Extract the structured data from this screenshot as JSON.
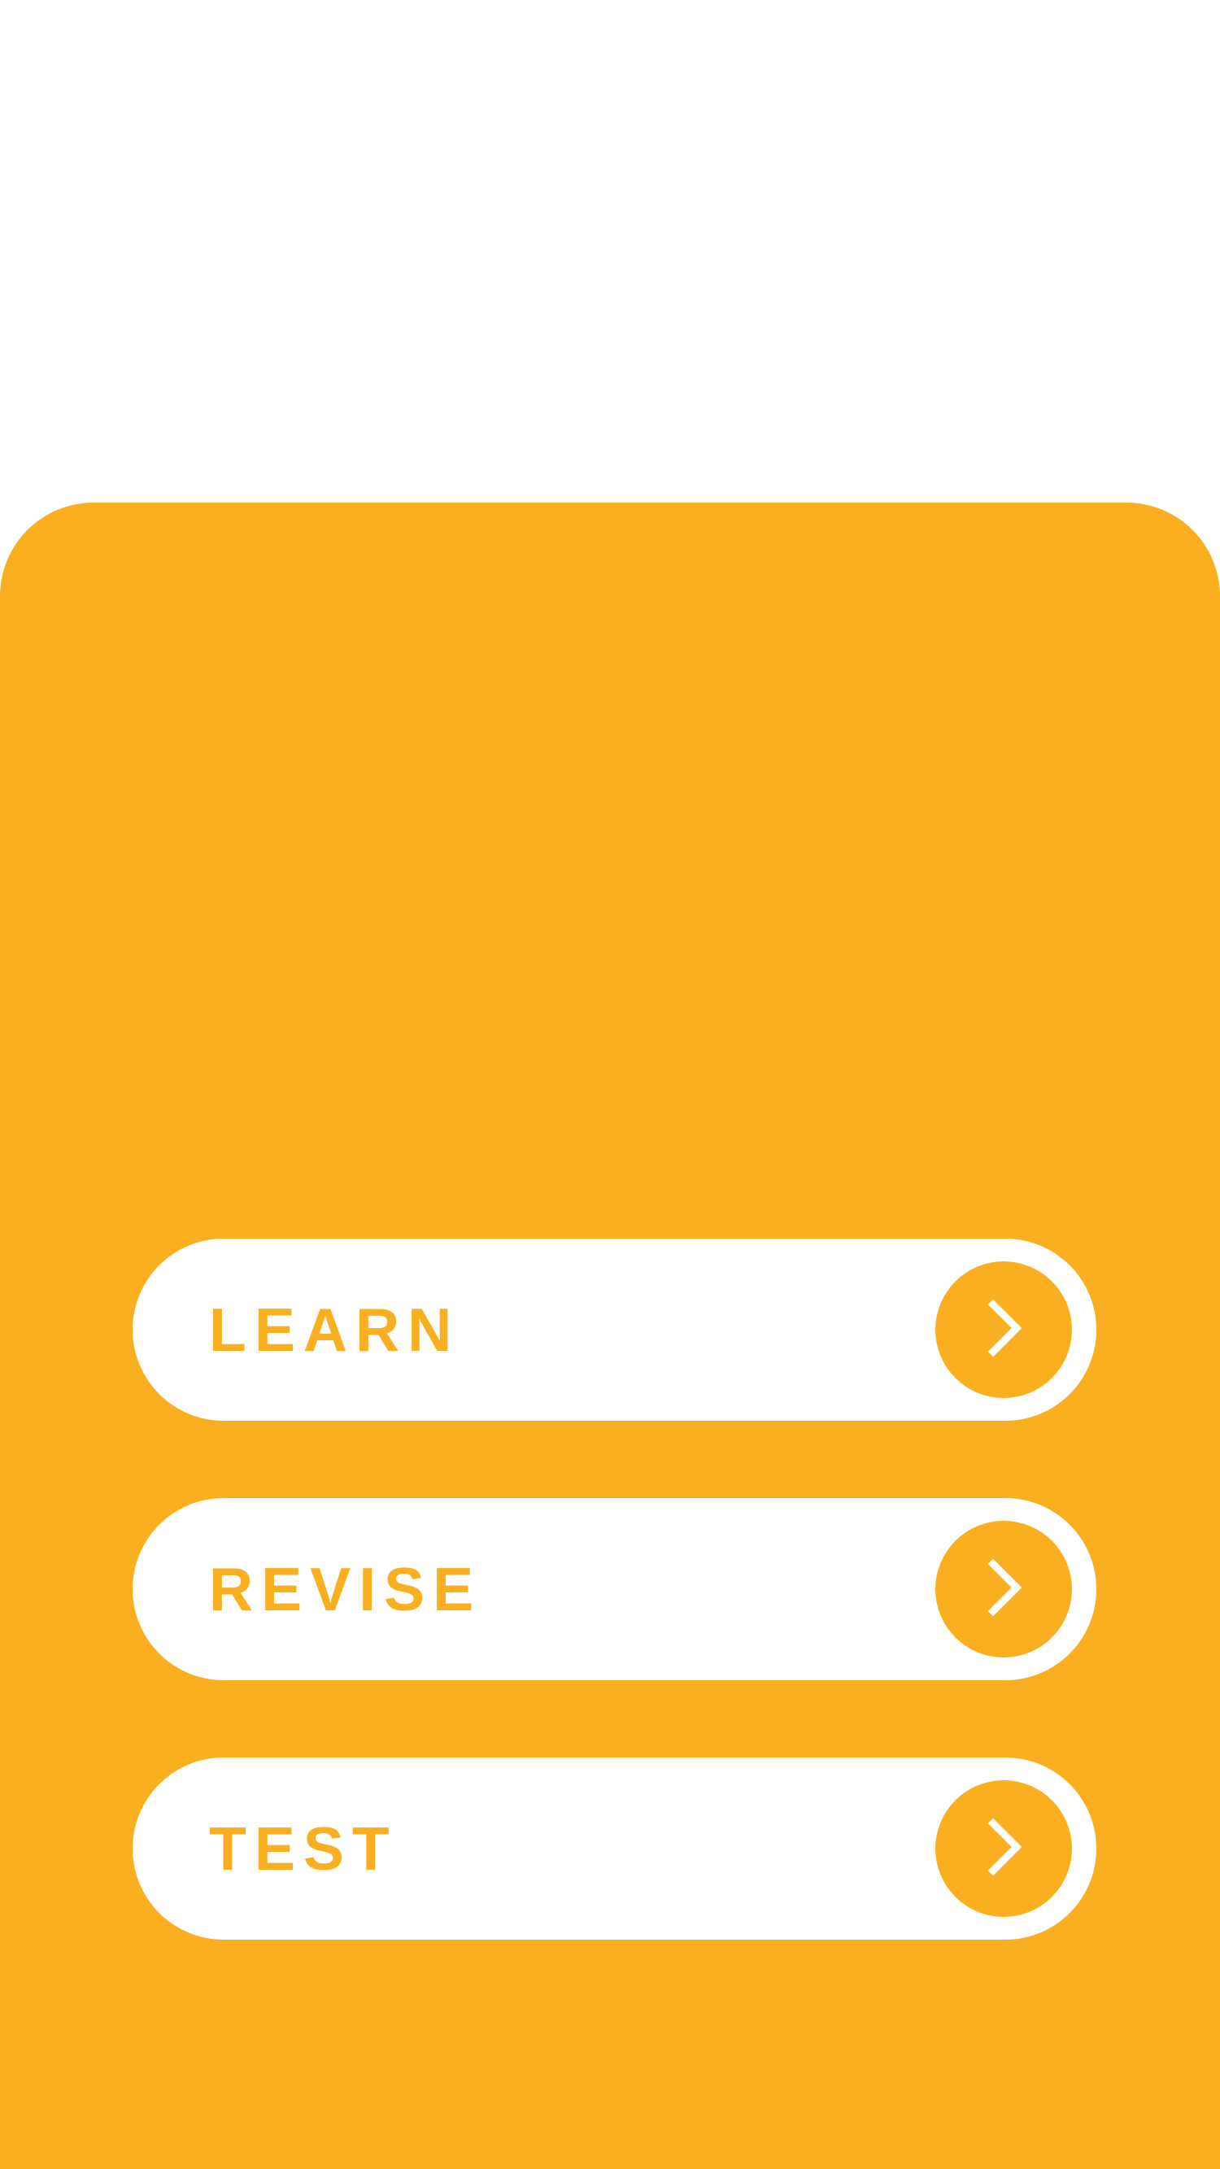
{
  "theme": {
    "accent": "#F9AF1F",
    "surface": "#FFFFFF"
  },
  "menu": {
    "items": [
      {
        "id": "learn",
        "label": "LEARN",
        "icon": "chevron-right-icon"
      },
      {
        "id": "revise",
        "label": "REVISE",
        "icon": "chevron-right-icon"
      },
      {
        "id": "test",
        "label": "TEST",
        "icon": "chevron-right-icon"
      }
    ]
  }
}
